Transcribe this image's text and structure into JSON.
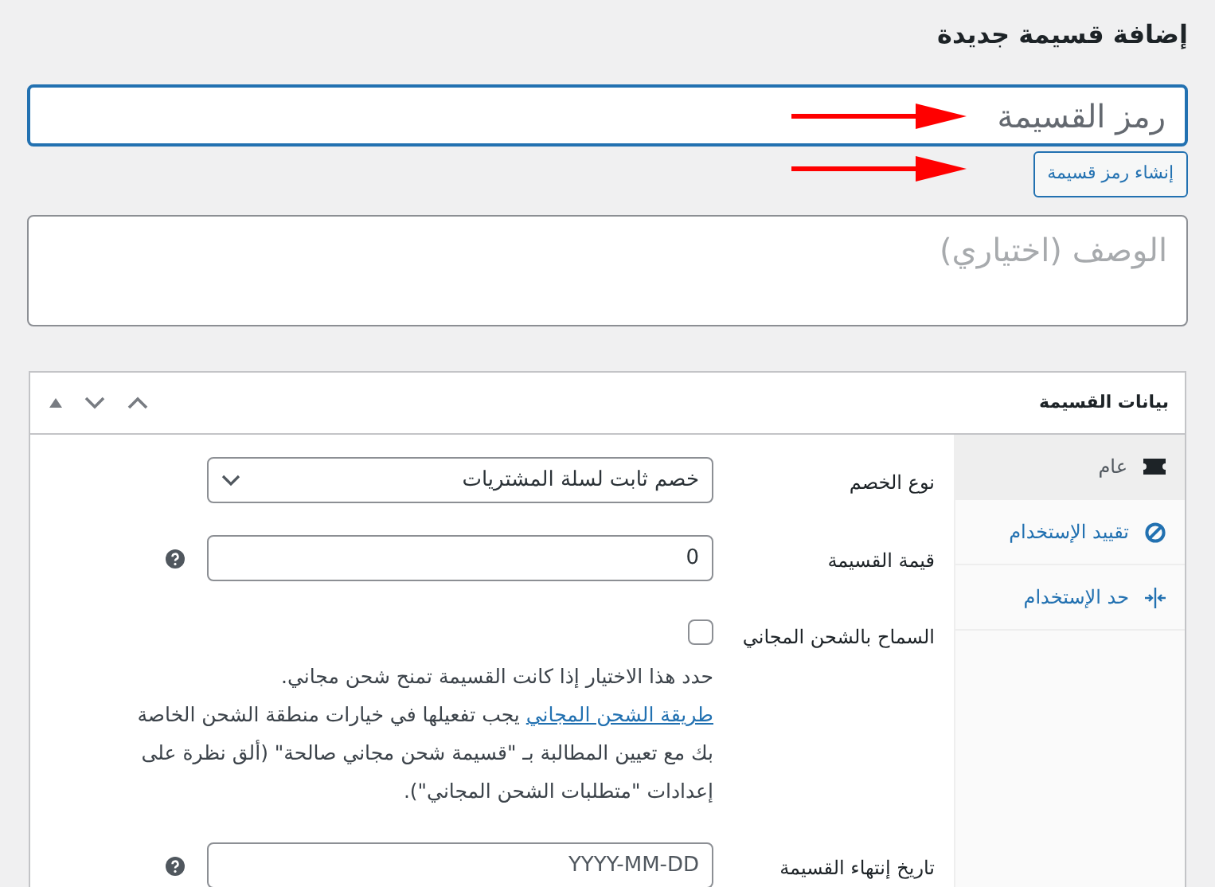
{
  "heading": "إضافة قسيمة جديدة",
  "code_field": {
    "placeholder": "رمز القسيمة"
  },
  "generate_button": "إنشاء رمز قسيمة",
  "description_field": {
    "placeholder": "الوصف (اختياري)"
  },
  "panel": {
    "title": "بيانات القسيمة",
    "tabs": [
      {
        "kind": "general",
        "label": "عام",
        "selected": true
      },
      {
        "kind": "restriction",
        "label": "تقييد الإستخدام",
        "selected": false
      },
      {
        "kind": "limit",
        "label": "حد الإستخدام",
        "selected": false
      }
    ],
    "fields": [
      {
        "kind": "select",
        "label": "نوع الخصم",
        "value": "خصم ثابت لسلة المشتريات"
      },
      {
        "kind": "text",
        "label": "قيمة القسيمة",
        "value": "0",
        "help": true
      },
      {
        "kind": "checkbox",
        "label": "السماح بالشحن المجاني",
        "checked": false,
        "description": {
          "before": "حدد هذا الاختيار إذا كانت القسيمة تمنح شحن مجاني.",
          "link": "طريقة الشحن المجاني",
          "after": "يجب تفعيلها في خيارات منطقة الشحن الخاصة بك مع تعيين المطالبة بـ \"قسيمة شحن مجاني صالحة\" (ألق نظرة على إعدادات \"متطلبات الشحن المجاني\")."
        }
      },
      {
        "kind": "text",
        "label": "تاريخ إنتهاء القسيمة",
        "placeholder": "YYYY-MM-DD",
        "help": true
      }
    ]
  }
}
